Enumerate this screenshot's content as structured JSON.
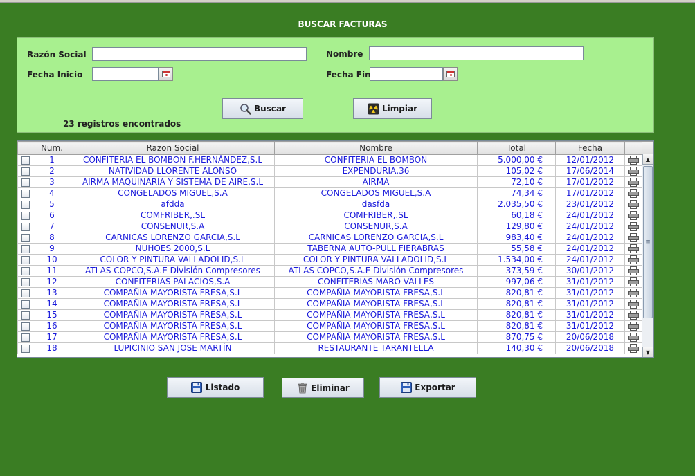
{
  "title": "BUSCAR FACTURAS",
  "filters": {
    "razon_social_label": "Razón Social",
    "razon_social_value": "",
    "nombre_label": "Nombre",
    "nombre_value": "",
    "fecha_inicio_label": "Fecha Inicio",
    "fecha_inicio_value": "",
    "fecha_fin_label": "Fecha Fin",
    "fecha_fin_value": ""
  },
  "buttons": {
    "buscar": "Buscar",
    "limpiar": "Limpiar",
    "listado": "Listado",
    "eliminar": "Eliminar",
    "exportar": "Exportar"
  },
  "result_count": "23 registros encontrados",
  "table": {
    "headers": [
      "",
      "Num.",
      "Razon Social",
      "Nombre",
      "Total",
      "Fecha",
      ""
    ],
    "rows": [
      {
        "num": "1",
        "razon": "CONFITERIA EL BOMBON F.HERNÁNDEZ,S.L",
        "nombre": "CONFITERIA EL BOMBON",
        "total": "5.000,00 €",
        "fecha": "12/01/2012"
      },
      {
        "num": "2",
        "razon": "NATIVIDAD LLORENTE ALONSO",
        "nombre": "EXPENDURIA,36",
        "total": "105,02 €",
        "fecha": "17/06/2014"
      },
      {
        "num": "3",
        "razon": "AIRMA MAQUINARIA Y SISTEMA DE AIRE,S.L",
        "nombre": "AIRMA",
        "total": "72,10 €",
        "fecha": "17/01/2012"
      },
      {
        "num": "4",
        "razon": "CONGELADOS MIGUEL,S.A",
        "nombre": "CONGELADOS MIGUEL,S.A",
        "total": "74,34 €",
        "fecha": "17/01/2012"
      },
      {
        "num": "5",
        "razon": "afdda",
        "nombre": "dasfda",
        "total": "2.035,50 €",
        "fecha": "23/01/2012"
      },
      {
        "num": "6",
        "razon": "COMFRIBER,.SL",
        "nombre": "COMFRIBER,.SL",
        "total": "60,18 €",
        "fecha": "24/01/2012"
      },
      {
        "num": "7",
        "razon": "CONSENUR,S.A",
        "nombre": "CONSENUR,S.A",
        "total": "129,80 €",
        "fecha": "24/01/2012"
      },
      {
        "num": "8",
        "razon": "CARNICAS LORENZO GARCIA,S.L",
        "nombre": "CARNICAS LORENZO GARCIA,S.L",
        "total": "983,40 €",
        "fecha": "24/01/2012"
      },
      {
        "num": "9",
        "razon": "NUHOES 2000,S.L",
        "nombre": "TABERNA AUTO-PULL FIERABRAS",
        "total": "55,58 €",
        "fecha": "24/01/2012"
      },
      {
        "num": "10",
        "razon": "COLOR Y PINTURA VALLADOLID,S.L",
        "nombre": "COLOR Y PINTURA VALLADOLID,S.L",
        "total": "1.534,00 €",
        "fecha": "24/01/2012"
      },
      {
        "num": "11",
        "razon": "ATLAS COPCO,S.A.E División Compresores",
        "nombre": "ATLAS COPCO,S.A.E División Compresores",
        "total": "373,59 €",
        "fecha": "30/01/2012"
      },
      {
        "num": "12",
        "razon": "CONFITERIAS PALACIOS,S.A",
        "nombre": "CONFITERIAS MARO VALLES",
        "total": "997,06 €",
        "fecha": "31/01/2012"
      },
      {
        "num": "13",
        "razon": "COMPAÑIA MAYORISTA FRESA,S.L",
        "nombre": "COMPAÑIA MAYORISTA FRESA,S.L",
        "total": "820,81 €",
        "fecha": "31/01/2012"
      },
      {
        "num": "14",
        "razon": "COMPAÑIA MAYORISTA FRESA,S.L",
        "nombre": "COMPAÑIA MAYORISTA FRESA,S.L",
        "total": "820,81 €",
        "fecha": "31/01/2012"
      },
      {
        "num": "15",
        "razon": "COMPAÑIA MAYORISTA FRESA,S.L",
        "nombre": "COMPAÑIA MAYORISTA FRESA,S.L",
        "total": "820,81 €",
        "fecha": "31/01/2012"
      },
      {
        "num": "16",
        "razon": "COMPAÑIA MAYORISTA FRESA,S.L",
        "nombre": "COMPAÑIA MAYORISTA FRESA,S.L",
        "total": "820,81 €",
        "fecha": "31/01/2012"
      },
      {
        "num": "17",
        "razon": "COMPAÑIA MAYORISTA FRESA,S.L",
        "nombre": "COMPAÑIA MAYORISTA FRESA,S.L",
        "total": "870,75 €",
        "fecha": "20/06/2018"
      },
      {
        "num": "18",
        "razon": "LUPICINIO SAN JOSE MARTÍN",
        "nombre": "RESTAURANTE TARANTELLA",
        "total": "140,30 €",
        "fecha": "20/06/2018"
      }
    ]
  },
  "icons": {
    "calendar": "calendar-icon",
    "search": "magnifier-icon",
    "clear": "radiation-icon",
    "save": "floppy-disk-icon",
    "delete": "trash-icon",
    "print": "printer-icon"
  },
  "colors": {
    "background": "#3a7d23",
    "filter_panel": "#a8f08f",
    "table_text": "#1a1adb"
  }
}
